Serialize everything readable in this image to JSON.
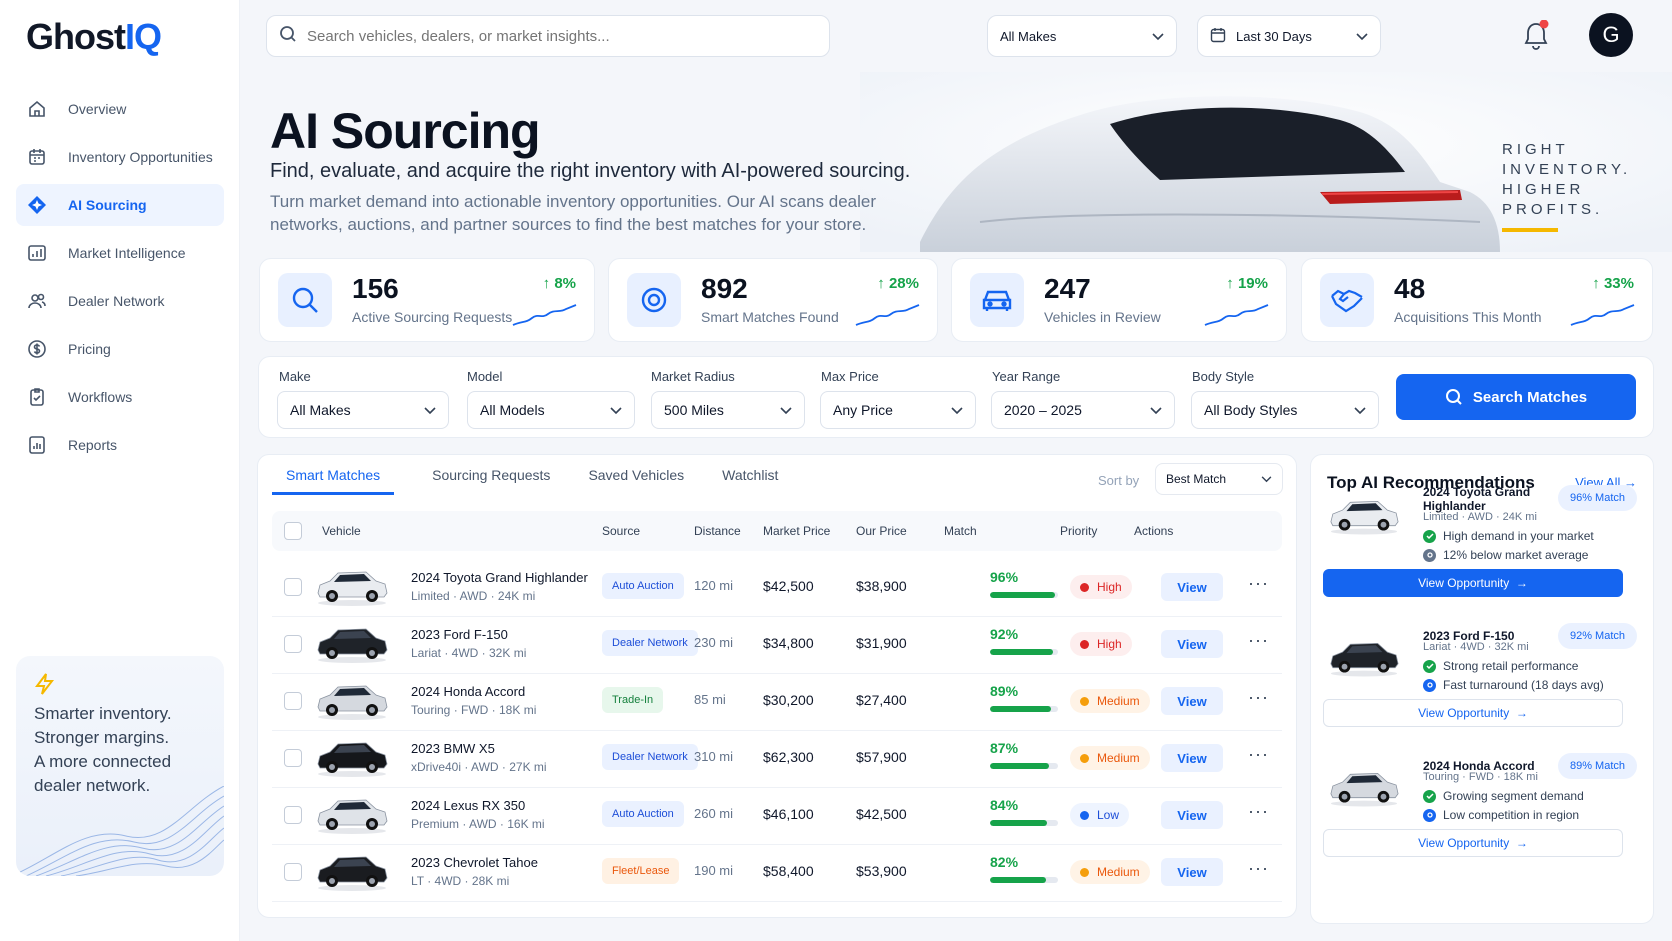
{
  "brand": {
    "name_a": "Ghost",
    "name_b": "IQ",
    "accent": "#1565f0"
  },
  "sidebar": {
    "items": [
      {
        "label": "Overview",
        "icon": "home-icon",
        "active": false
      },
      {
        "label": "Inventory Opportunities",
        "icon": "calendar-icon",
        "active": false
      },
      {
        "label": "AI Sourcing",
        "icon": "diamond-icon",
        "active": true
      },
      {
        "label": "Market Intelligence",
        "icon": "chart-icon",
        "active": false
      },
      {
        "label": "Dealer Network",
        "icon": "users-icon",
        "active": false
      },
      {
        "label": "Pricing",
        "icon": "dollar-icon",
        "active": false
      },
      {
        "label": "Workflows",
        "icon": "workflow-icon",
        "active": false
      },
      {
        "label": "Reports",
        "icon": "report-icon",
        "active": false
      }
    ],
    "promo": {
      "line1": "Smarter inventory.",
      "line2": "Stronger margins.",
      "line3": "A more connected",
      "line4": "dealer network."
    }
  },
  "topbar": {
    "search_placeholder": "Search vehicles, dealers, or market insights...",
    "makes": "All Makes",
    "range": "Last 30 Days",
    "avatar": "G"
  },
  "hero": {
    "title": "AI Sourcing",
    "subtitle": "Find, evaluate, and acquire the right inventory with AI-powered sourcing.",
    "desc": "Turn market demand into actionable inventory opportunities. Our AI scans dealer networks, auctions, and partner sources to find the best matches for your store.",
    "tag1": "RIGHT",
    "tag2": "INVENTORY.",
    "tag3": "HIGHER",
    "tag4": "PROFITS."
  },
  "stats": [
    {
      "value": "156",
      "label": "Active Sourcing Requests",
      "change": "8%",
      "icon": "search-icon"
    },
    {
      "value": "892",
      "label": "Smart Matches Found",
      "change": "28%",
      "icon": "target-icon"
    },
    {
      "value": "247",
      "label": "Vehicles in Review",
      "change": "19%",
      "icon": "car-icon"
    },
    {
      "value": "48",
      "label": "Acquisitions This Month",
      "change": "33%",
      "icon": "handshake-icon"
    }
  ],
  "filters": {
    "make": {
      "label": "Make",
      "value": "All Makes"
    },
    "model": {
      "label": "Model",
      "value": "All Models"
    },
    "radius": {
      "label": "Market Radius",
      "value": "500 Miles"
    },
    "price": {
      "label": "Max Price",
      "value": "Any Price"
    },
    "year": {
      "label": "Year Range",
      "value": "2020 – 2025"
    },
    "body": {
      "label": "Body Style",
      "value": "All Body Styles"
    },
    "button": "Search Matches"
  },
  "tabs": [
    "Smart Matches",
    "Sourcing Requests",
    "Saved Vehicles",
    "Watchlist"
  ],
  "sort": {
    "label": "Sort by",
    "value": "Best Match"
  },
  "columns": [
    "Vehicle",
    "Source",
    "Distance",
    "Market Price",
    "Our Price",
    "Match",
    "Priority",
    "Actions"
  ],
  "rows": [
    {
      "name": "2024 Toyota Grand Highlander",
      "sub": "Limited · AWD · 24K mi",
      "source": "Auto Auction",
      "source_type": "blue",
      "distance": "120 mi",
      "market": "$42,500",
      "ours": "$38,900",
      "match": "96%",
      "match_frac": 0.96,
      "priority": "High",
      "pri_type": "high",
      "car_color": "#e9ecf0",
      "action": "View"
    },
    {
      "name": "2023 Ford F-150",
      "sub": "Lariat · 4WD · 32K mi",
      "source": "Dealer Network",
      "source_type": "blue",
      "distance": "230 mi",
      "market": "$34,800",
      "ours": "$31,900",
      "match": "92%",
      "match_frac": 0.92,
      "priority": "High",
      "pri_type": "high",
      "car_color": "#1f2329",
      "action": "View"
    },
    {
      "name": "2024 Honda Accord",
      "sub": "Touring · FWD · 18K mi",
      "source": "Trade-In",
      "source_type": "green",
      "distance": "85 mi",
      "market": "$30,200",
      "ours": "$27,400",
      "match": "89%",
      "match_frac": 0.89,
      "priority": "Medium",
      "pri_type": "med",
      "car_color": "#d5d9df",
      "action": "View"
    },
    {
      "name": "2023 BMW X5",
      "sub": "xDrive40i · AWD · 27K mi",
      "source": "Dealer Network",
      "source_type": "blue",
      "distance": "310 mi",
      "market": "$62,300",
      "ours": "$57,900",
      "match": "87%",
      "match_frac": 0.87,
      "priority": "Medium",
      "pri_type": "med",
      "car_color": "#15171b",
      "action": "View"
    },
    {
      "name": "2024 Lexus RX 350",
      "sub": "Premium · AWD · 16K mi",
      "source": "Auto Auction",
      "source_type": "blue",
      "distance": "260 mi",
      "market": "$46,100",
      "ours": "$42,500",
      "match": "84%",
      "match_frac": 0.84,
      "priority": "Low",
      "pri_type": "low",
      "car_color": "#dfe3e8",
      "action": "View"
    },
    {
      "name": "2023 Chevrolet Tahoe",
      "sub": "LT · 4WD · 28K mi",
      "source": "Fleet/Lease",
      "source_type": "orange",
      "distance": "190 mi",
      "market": "$58,400",
      "ours": "$53,900",
      "match": "82%",
      "match_frac": 0.82,
      "priority": "Medium",
      "pri_type": "med",
      "car_color": "#1a1c20",
      "action": "View"
    }
  ],
  "recs": {
    "title": "Top AI Recommendations",
    "view_all": "View All",
    "items": [
      {
        "name": "2024 Toyota Grand Highlander",
        "sub": "Limited · AWD · 24K mi",
        "match": "96% Match",
        "p1": "High demand in your market",
        "p2": "12% below market average",
        "button": "View Opportunity",
        "car_color": "#e9ecf0"
      },
      {
        "name": "2023 Ford F-150",
        "sub": "Lariat · 4WD · 32K mi",
        "match": "92% Match",
        "p1": "Strong retail performance",
        "p2": "Fast turnaround (18 days avg)",
        "button": "View Opportunity",
        "car_color": "#1f2329"
      },
      {
        "name": "2024 Honda Accord",
        "sub": "Touring · FWD · 18K mi",
        "match": "89% Match",
        "p1": "Growing segment demand",
        "p2": "Low competition in region",
        "button": "View Opportunity",
        "car_color": "#d5d9df"
      }
    ]
  }
}
